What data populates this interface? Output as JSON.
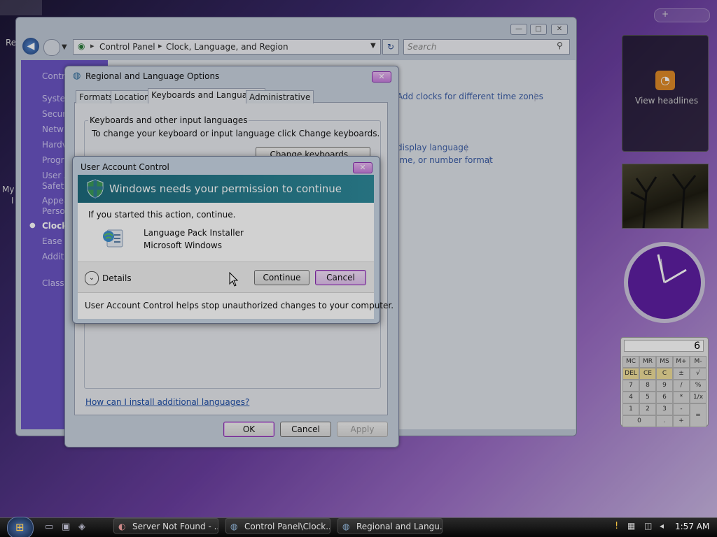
{
  "control_panel": {
    "breadcrumb": [
      "Control Panel",
      "Clock, Language, and Region"
    ],
    "search_placeholder": "Search",
    "sidebar_items": [
      "Contro",
      "Syster",
      "Secur",
      "Netw",
      "Hardv",
      "Progr",
      "User A",
      "Safety",
      "Appea",
      "Person",
      "Clock,",
      "Ease o",
      "Additi",
      "Classi"
    ],
    "links": {
      "add_clocks": "Add clocks for different time zones",
      "display_language": "display language",
      "number_format": "ime, or number format"
    }
  },
  "regional_dialog": {
    "title": "Regional and Language Options",
    "tabs": [
      "Formats",
      "Location",
      "Keyboards and Languages",
      "Administrative"
    ],
    "group_label": "Keyboards and other input languages",
    "group_text": "To change your keyboard or input language click Change keyboards.",
    "change_keyboards": "Change keyboards...",
    "help_link": "How can I install additional languages?",
    "ok": "OK",
    "cancel": "Cancel",
    "apply": "Apply"
  },
  "uac_dialog": {
    "title": "User Account Control",
    "headline": "Windows needs your permission to continue",
    "prompt": "If you started this action, continue.",
    "program_name": "Language Pack Installer",
    "publisher": "Microsoft Windows",
    "details": "Details",
    "continue": "Continue",
    "cancel": "Cancel",
    "footer": "User Account Control helps stop unauthorized changes to your computer."
  },
  "gadgets": {
    "feed_text": "View headlines",
    "calculator": {
      "display": "6",
      "keys": [
        "MC",
        "MR",
        "MS",
        "M+",
        "M-",
        "DEL",
        "CE",
        "C",
        "±",
        "√",
        "7",
        "8",
        "9",
        "/",
        "%",
        "4",
        "5",
        "6",
        "*",
        "1/x",
        "1",
        "2",
        "3",
        "-",
        "=",
        "0",
        ".",
        "+"
      ]
    }
  },
  "desktop_labels": [
    "Re",
    "My",
    "I"
  ],
  "taskbar": {
    "tasks": [
      "Server Not Found - ...",
      "Control Panel\\Clock...",
      "Regional and Langu..."
    ],
    "clock": "1:57 AM"
  }
}
